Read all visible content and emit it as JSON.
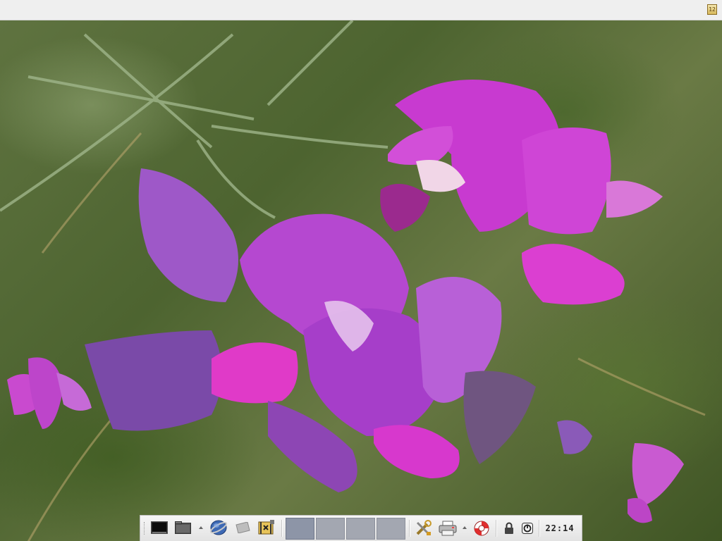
{
  "topbar": {
    "icon": "notes-icon",
    "icon_glyph": "12"
  },
  "taskbar": {
    "launchers": [
      {
        "name": "terminal-icon"
      },
      {
        "name": "file-manager-icon"
      },
      {
        "name": "web-browser-icon"
      },
      {
        "name": "mail-icon"
      },
      {
        "name": "media-player-icon"
      }
    ],
    "pager": {
      "workspaces": 4,
      "active": 0
    },
    "tray": [
      {
        "name": "settings-tools-icon"
      },
      {
        "name": "printer-icon"
      },
      {
        "name": "help-lifebuoy-icon"
      },
      {
        "name": "lock-icon"
      },
      {
        "name": "power-icon"
      }
    ],
    "clock": "22:14"
  },
  "colors": {
    "taskbar_bg": "#ececec",
    "pager_active": "#8d95a7",
    "pager_inactive": "#a3a7b1"
  }
}
